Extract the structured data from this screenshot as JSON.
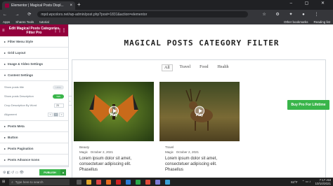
{
  "browser": {
    "tab_title": "Elementor | Magical Posts Displ...",
    "tab_close": "×",
    "new_tab": "+",
    "window_controls": "– ▢ ✕",
    "nav_buttons": "← → ⟳",
    "url": "mpd.wpcolors.net/wp-admin/post.php?post=1831&action=elementor",
    "extensions": "☆ ⚙ ✦ ● ⋮",
    "bookmarks": [
      "Apps",
      "Shares Tools",
      "tutorial"
    ],
    "bookmarks_right": [
      "Other bookmarks",
      "Reading list"
    ]
  },
  "panel": {
    "title": "Edit Magical Posts Categories Filter Pro",
    "menu_icon": "≡",
    "grid_icon": "⋮⋮⋮",
    "sections_top": [
      {
        "label": "Filter Menu Style"
      },
      {
        "label": "Grid Layout"
      },
      {
        "label": "Image & Video Settings"
      }
    ],
    "content_settings": {
      "label": "Content Settings",
      "show_posts_title": {
        "label": "Show posts title",
        "value": "HIDE"
      },
      "show_posts_description": {
        "label": "Show posts Description",
        "value": "YES"
      },
      "crop_description": {
        "label": "Crop Description By Word",
        "value": "25"
      },
      "alignment": {
        "label": "Alignment",
        "options": [
          "≡",
          "≡",
          "≡"
        ]
      }
    },
    "sections_bottom": [
      {
        "label": "Posts Meta"
      },
      {
        "label": "Button"
      },
      {
        "label": "Posts Pagination"
      },
      {
        "label": "Posts Advance Icons"
      }
    ],
    "footer_icons": "⚙ ◧ ↺ ▭ 👁",
    "publish_label": "PUBLISH",
    "publish_caret": "▲"
  },
  "canvas": {
    "collapse_icon": "‹",
    "title": "MAGICAL POSTS CATEGORY FILTER",
    "filters": [
      "All",
      "Travel",
      "Food",
      "Health"
    ],
    "active_filter": "All",
    "cards": [
      {
        "play_label": "Play",
        "category": "Beauty",
        "author": "Magic",
        "date": "October 2, 2021",
        "excerpt": "Lorem ipsum dolor sit amet, consectetuer adipiscing elit. Phasellus"
      },
      {
        "play_label": "Play",
        "category": "Travel",
        "author": "Magic",
        "date": "October 2, 2021",
        "excerpt": "Lorem ipsum dolor sit amet, consectetuer adipiscing elit. Phasellus"
      }
    ],
    "buy_pro_label": "Buy Pro For Lifetime"
  },
  "taskbar": {
    "start": "⊞",
    "search_placeholder": "Type here to search",
    "weather": "84°F",
    "time": "7:17 AM",
    "date": "10/10/2021"
  },
  "colors": {
    "elementor_header": "#93003c",
    "publish_green": "#39b54a"
  }
}
